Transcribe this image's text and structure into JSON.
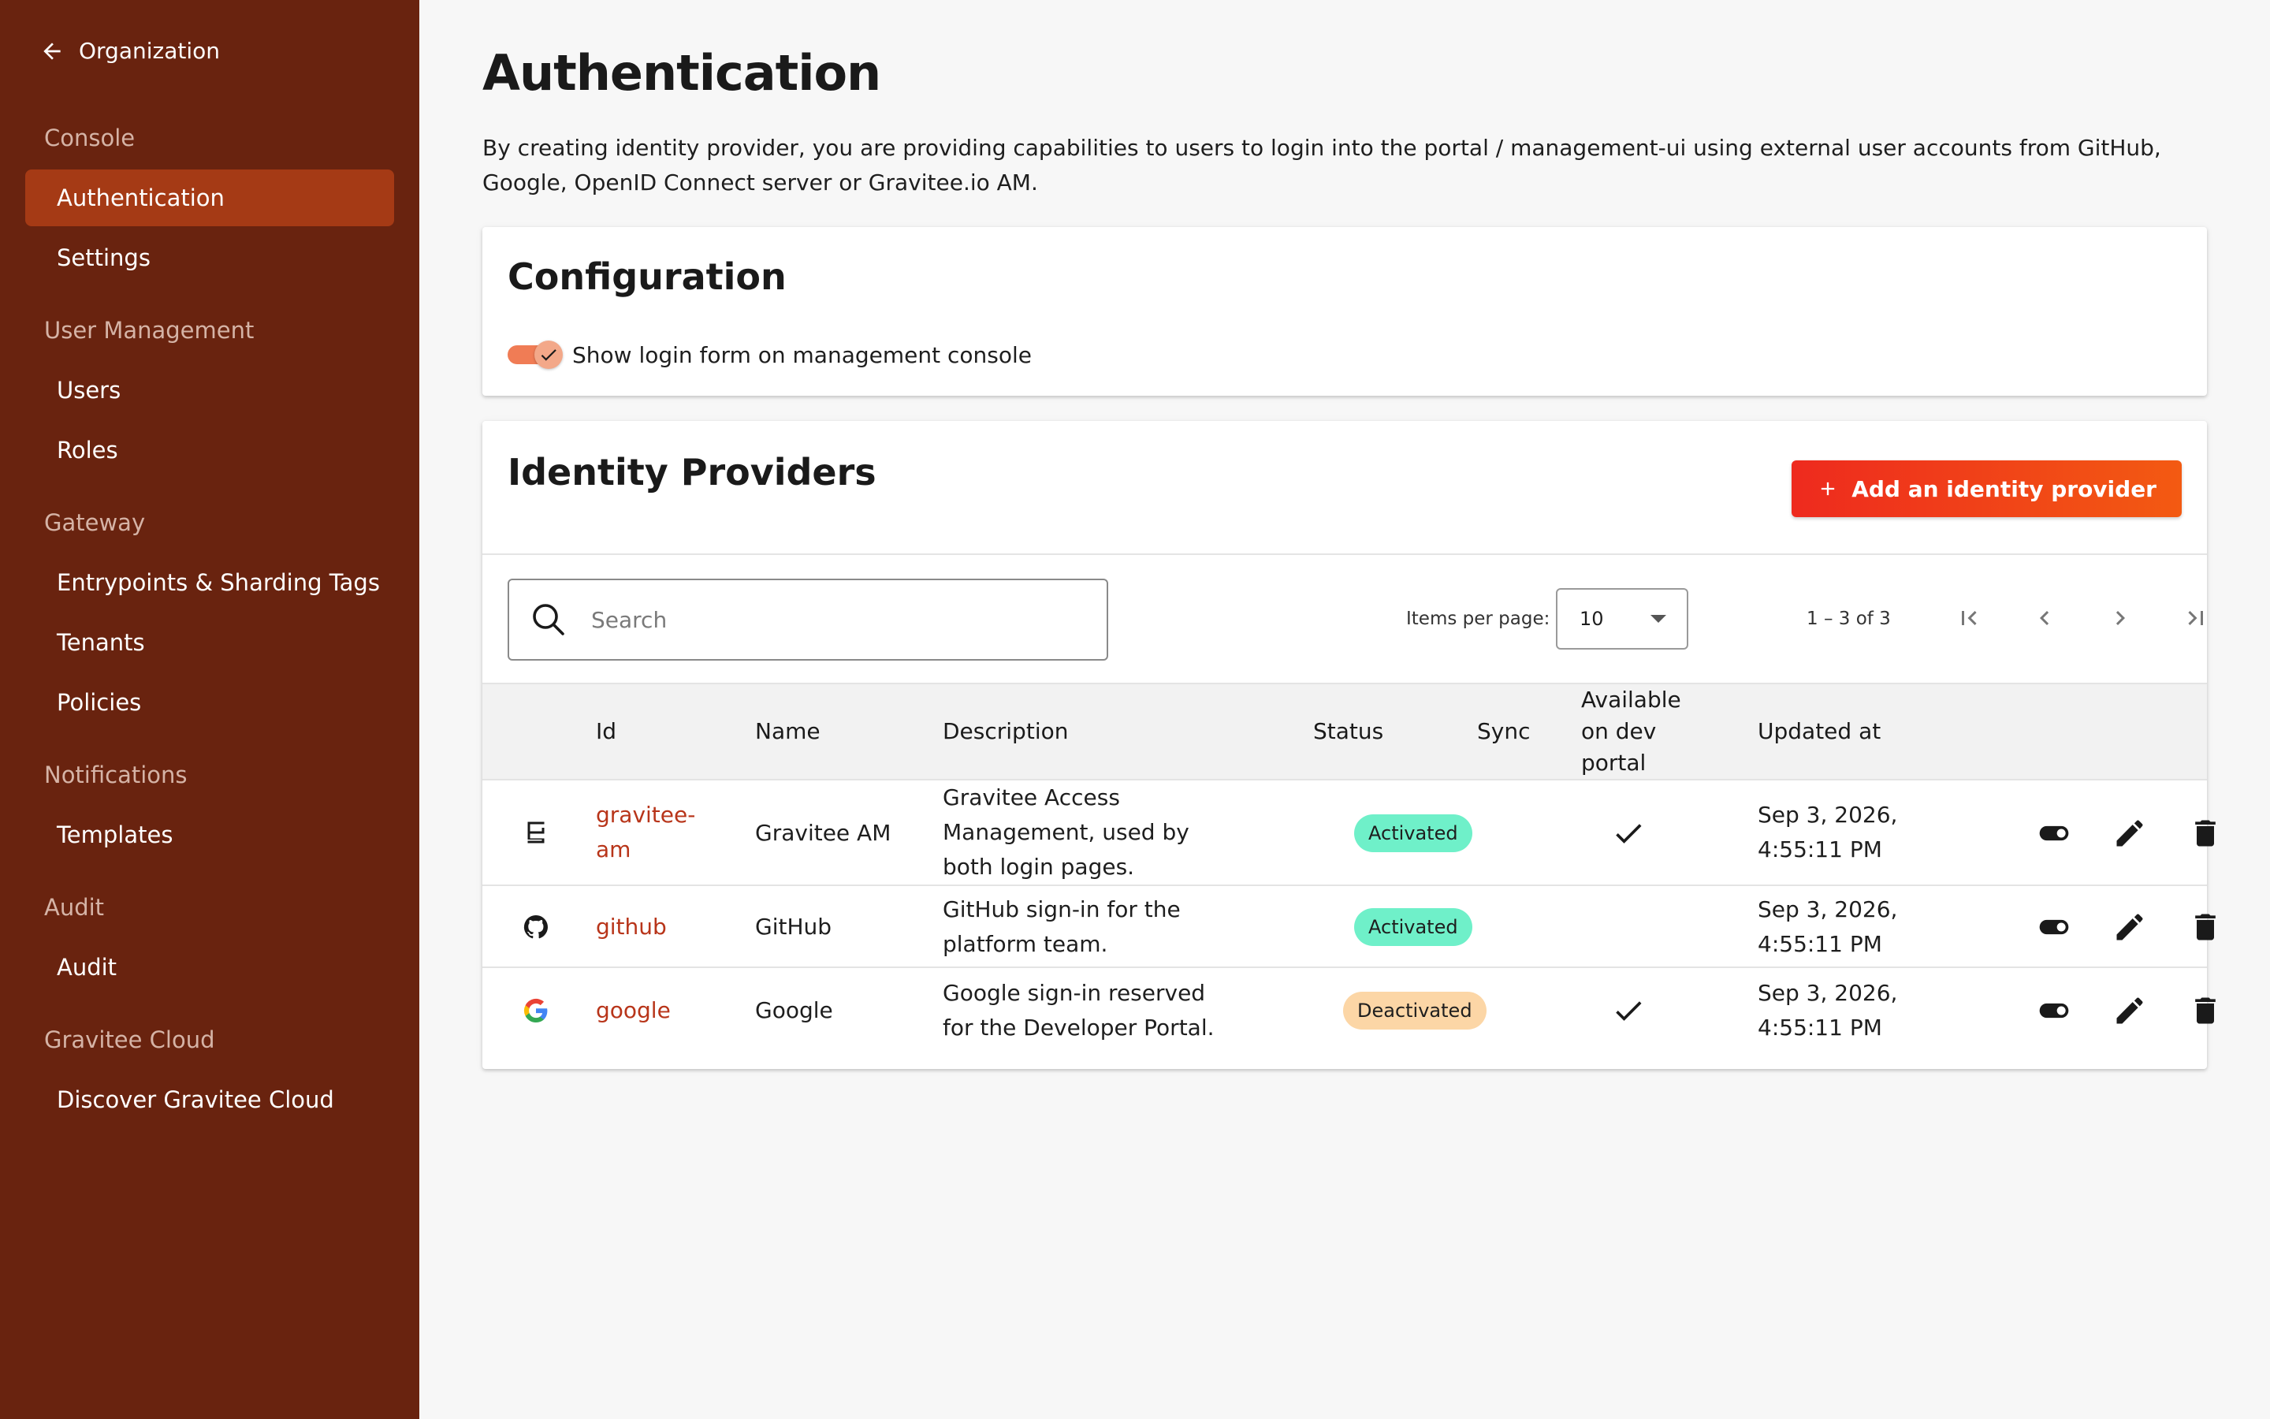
{
  "sidebar": {
    "back_label": "Organization",
    "groups": [
      {
        "title": "Console",
        "items": [
          {
            "label": "Authentication",
            "active": true
          },
          {
            "label": "Settings"
          }
        ]
      },
      {
        "title": "User Management",
        "items": [
          {
            "label": "Users"
          },
          {
            "label": "Roles"
          }
        ]
      },
      {
        "title": "Gateway",
        "items": [
          {
            "label": "Entrypoints & Sharding Tags"
          },
          {
            "label": "Tenants"
          },
          {
            "label": "Policies"
          }
        ]
      },
      {
        "title": "Notifications",
        "items": [
          {
            "label": "Templates"
          }
        ]
      },
      {
        "title": "Audit",
        "items": [
          {
            "label": "Audit"
          }
        ]
      },
      {
        "title": "Gravitee Cloud",
        "items": [
          {
            "label": "Discover Gravitee Cloud"
          }
        ]
      }
    ]
  },
  "page": {
    "title": "Authentication",
    "description": "By creating identity provider, you are providing capabilities to users to login into the portal / management-ui using external user accounts from GitHub, Google, OpenID Connect server or Gravitee.io AM."
  },
  "configuration": {
    "title": "Configuration",
    "toggle_label": "Show login form on management console",
    "toggle_on": true
  },
  "identity_providers": {
    "title": "Identity Providers",
    "add_button_label": "Add an identity provider",
    "search_placeholder": "Search",
    "items_per_page_label": "Items per page:",
    "items_per_page_value": "10",
    "range_label": "1 – 3 of 3",
    "columns": {
      "id": "Id",
      "name": "Name",
      "description": "Description",
      "status": "Status",
      "sync": "Sync",
      "available": "Available on dev portal",
      "updated": "Updated at"
    },
    "rows": [
      {
        "icon": "gravitee-icon",
        "id": "gravitee-am",
        "name": "Gravitee AM",
        "description": "Gravitee Access Management, used by both login pages.",
        "status": "Activated",
        "sync": "",
        "available": true,
        "updated": "Sep 3, 2026, 4:55:11 PM"
      },
      {
        "icon": "github-icon",
        "id": "github",
        "name": "GitHub",
        "description": "GitHub sign-in for the platform team.",
        "status": "Activated",
        "sync": "",
        "available": false,
        "updated": "Sep 3, 2026, 4:55:11 PM"
      },
      {
        "icon": "google-icon",
        "id": "google",
        "name": "Google",
        "description": "Google sign-in reserved for the Developer Portal.",
        "status": "Deactivated",
        "sync": "",
        "available": true,
        "updated": "Sep 3, 2026, 4:55:11 PM"
      }
    ]
  },
  "colors": {
    "sidebar_bg": "#69230f",
    "sidebar_active": "#a53a15",
    "accent": "#ee2a1e",
    "link": "#b8351a",
    "badge_activated": "#6ff0c9",
    "badge_deactivated": "#fcd6a6"
  }
}
